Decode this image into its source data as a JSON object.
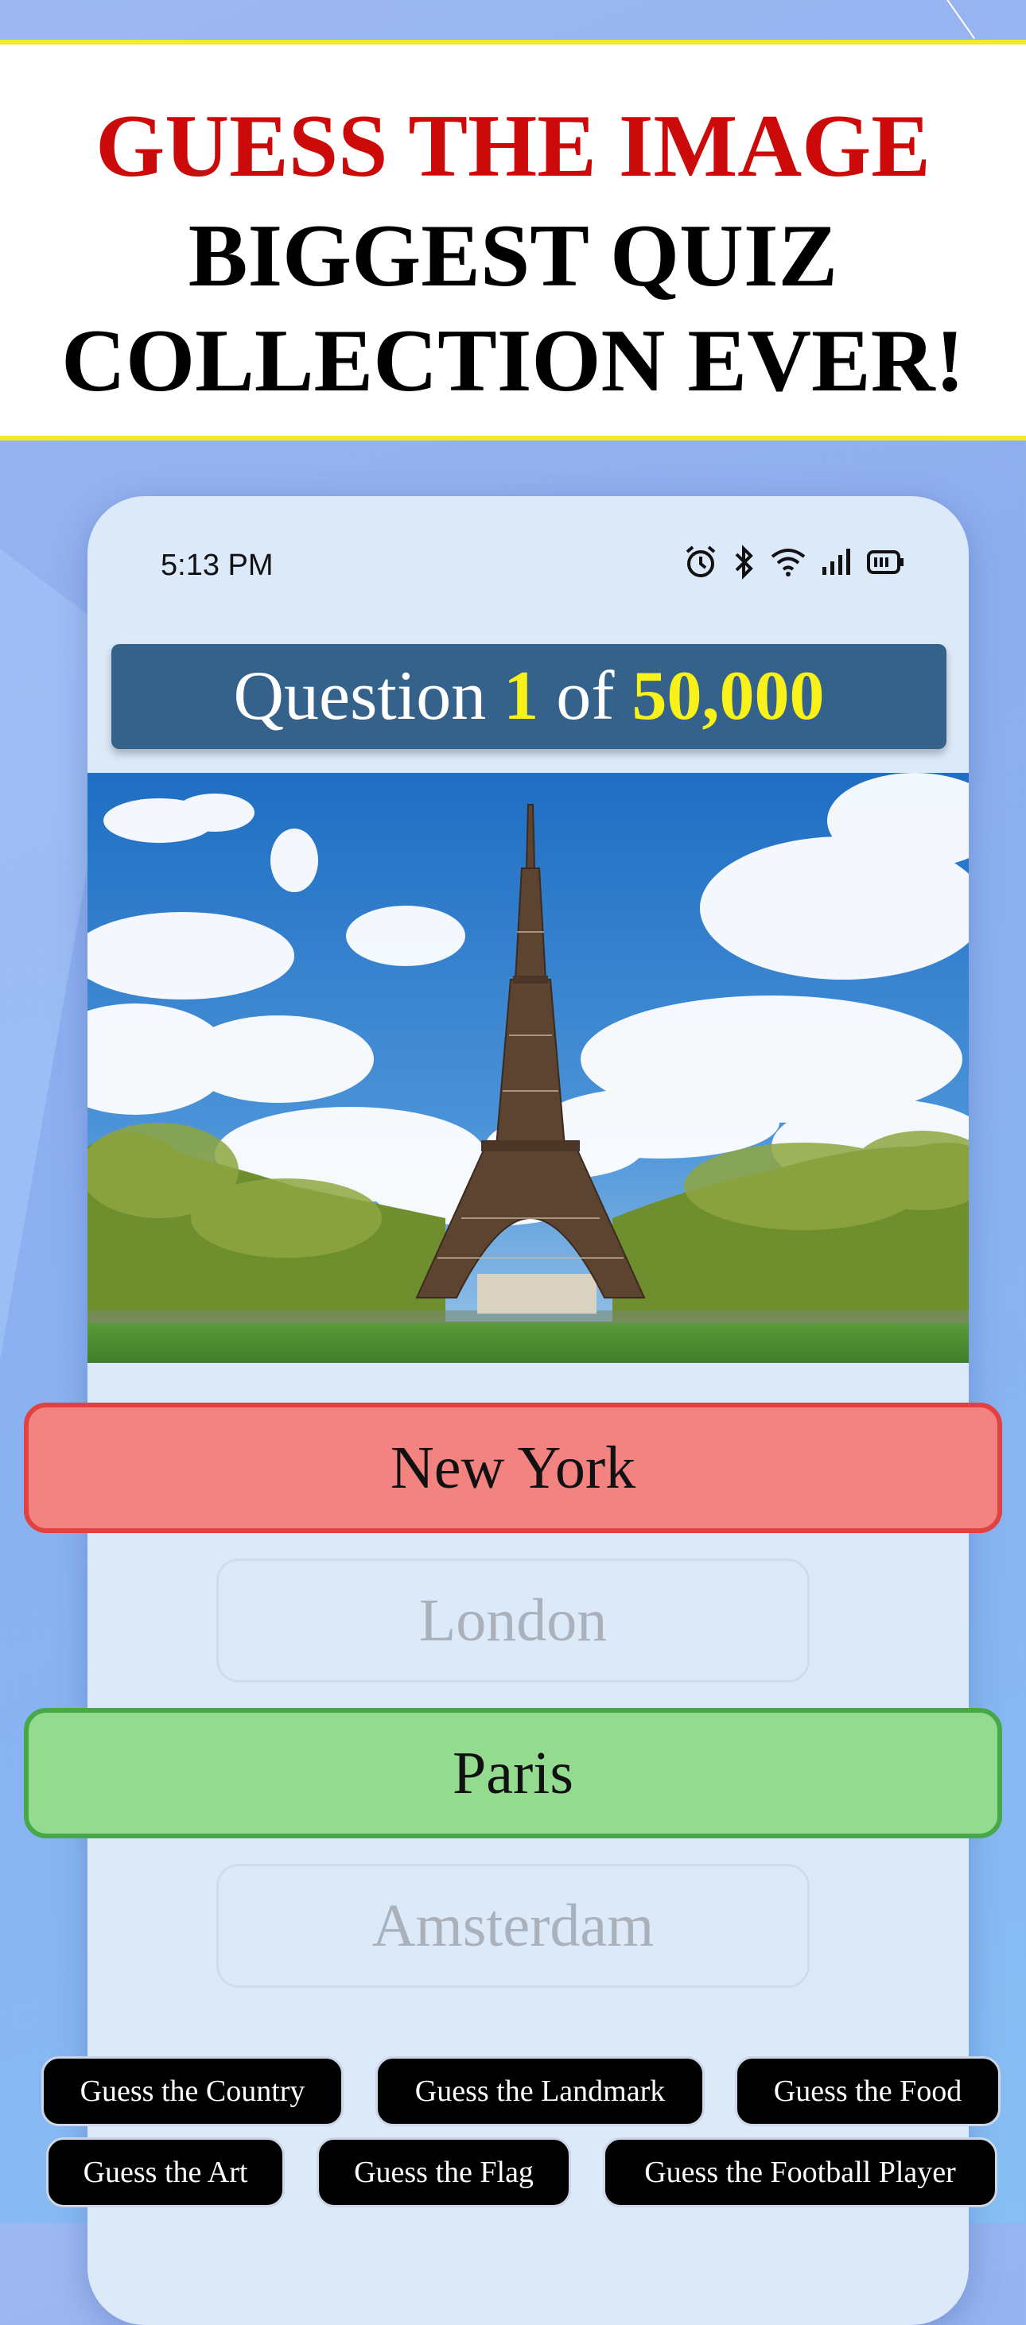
{
  "promo": {
    "line1": "GUESS THE IMAGE",
    "line2": "BIGGEST QUIZ",
    "line3": "COLLECTION EVER!"
  },
  "status_bar": {
    "time": "5:13 PM",
    "icons": [
      "alarm-icon",
      "bluetooth-icon",
      "wifi-icon",
      "signal-icon",
      "battery-icon"
    ]
  },
  "question": {
    "prefix": "Question",
    "current": "1",
    "of": "of",
    "total": "50,000"
  },
  "image": {
    "subject": "eiffel-tower-photo"
  },
  "answers": {
    "a1": "New York",
    "a2": "London",
    "a3": "Paris",
    "a4": "Amsterdam"
  },
  "categories": [
    "Guess the Country",
    "Guess the Landmark",
    "Guess the Food",
    "Guess the Art",
    "Guess the Flag",
    "Guess the Football Player"
  ],
  "colors": {
    "wrong": "#f38381",
    "correct": "#93dc8f",
    "question_bar": "#35628a",
    "highlight": "#f8f21a",
    "promo_red": "#cc0a0a"
  }
}
